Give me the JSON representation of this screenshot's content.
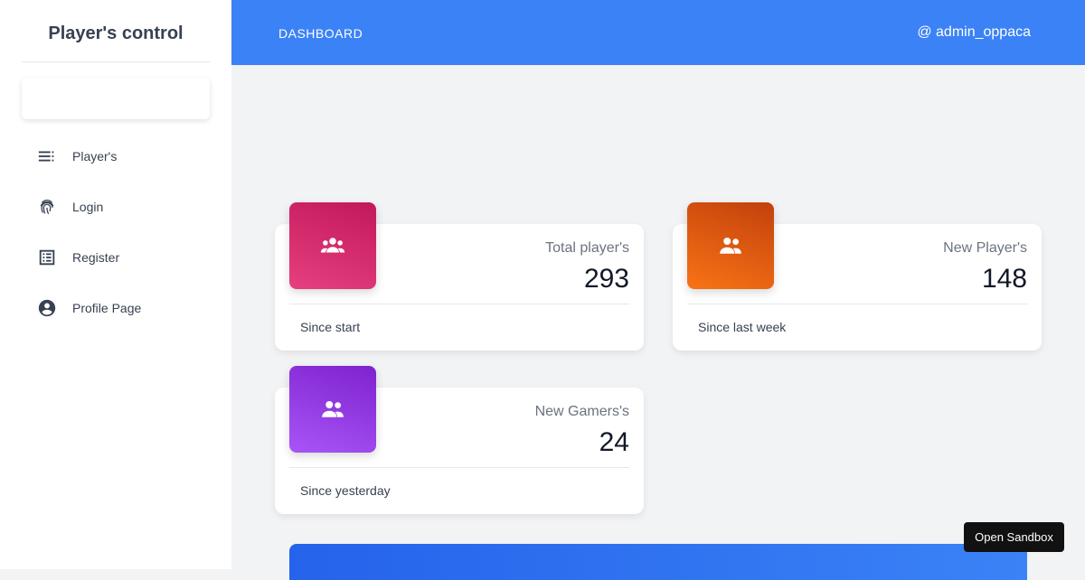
{
  "sidebar": {
    "brand": "Player's control",
    "items": [
      {
        "label": "Player's",
        "icon": "list-icon"
      },
      {
        "label": "Login",
        "icon": "fingerprint-icon"
      },
      {
        "label": "Register",
        "icon": "form-list-icon"
      },
      {
        "label": "Profile Page",
        "icon": "account-circle-icon"
      }
    ]
  },
  "header": {
    "title": "DASHBOARD",
    "user": "@ admin_oppaca"
  },
  "stats": [
    {
      "title": "Total player's",
      "value": "293",
      "footer": "Since start",
      "icon": "group-icon",
      "color": "#d63384"
    },
    {
      "title": "New Player's",
      "value": "148",
      "footer": "Since last week",
      "icon": "group-icon",
      "color": "#ea580c"
    },
    {
      "title": "New Gamers's",
      "value": "24",
      "footer": "Since yesterday",
      "icon": "group-icon",
      "color": "#9333ea"
    }
  ],
  "sandbox": {
    "label": "Open Sandbox"
  },
  "colors": {
    "header": "#3b82f6",
    "background": "#f2f3f5"
  }
}
